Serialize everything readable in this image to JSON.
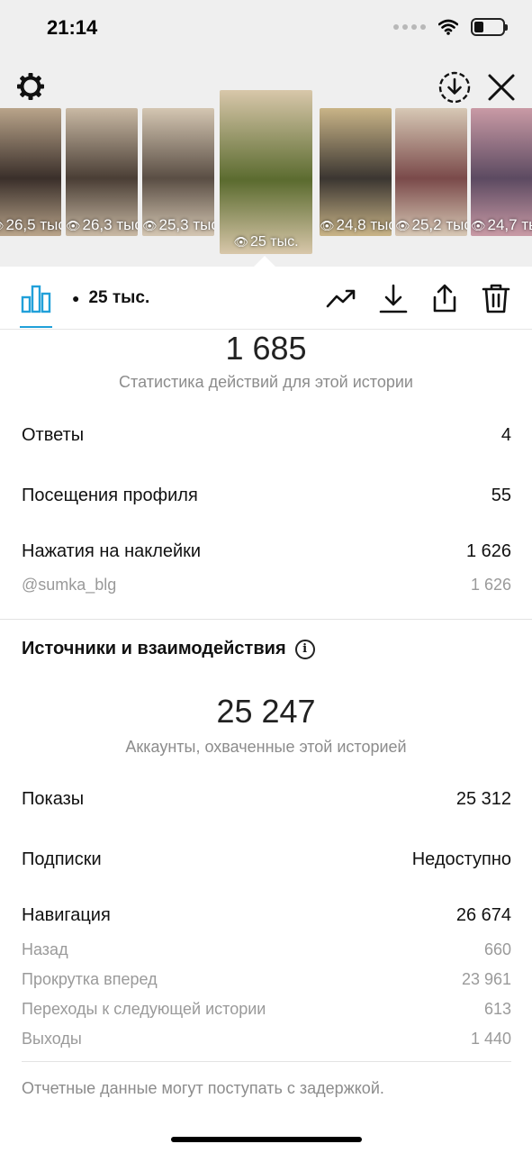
{
  "status": {
    "time": "21:14"
  },
  "stories": [
    {
      "views": "26,5 тыс.",
      "colors": [
        "#3a2f2a",
        "#b9a48a"
      ]
    },
    {
      "views": "26,3 тыс.",
      "colors": [
        "#4a3e35",
        "#c9b9a4"
      ]
    },
    {
      "views": "25,3 тыс.",
      "colors": [
        "#5a4e44",
        "#d4c6b2"
      ]
    },
    {
      "views": "25 тыс.",
      "colors": [
        "#5b6b2f",
        "#d8c7aa"
      ],
      "selected": true
    },
    {
      "views": "24,8 тыс.",
      "colors": [
        "#3b3631",
        "#c9b487"
      ]
    },
    {
      "views": "25,2 тыс.",
      "colors": [
        "#7a4a4a",
        "#d7c8b5"
      ]
    },
    {
      "views": "24,7 тыс.",
      "colors": [
        "#5c4a61",
        "#c99aa5"
      ]
    }
  ],
  "toolbar": {
    "views_label": "25 тыс."
  },
  "actions": {
    "total": "1 685",
    "caption": "Статистика действий для этой истории",
    "replies_label": "Ответы",
    "replies_value": "4",
    "profile_visits_label": "Посещения профиля",
    "profile_visits_value": "55",
    "sticker_taps_label": "Нажатия на наклейки",
    "sticker_taps_value": "1 626",
    "sticker_handle": "@sumka_blg",
    "sticker_handle_value": "1 626"
  },
  "discovery": {
    "title": "Источники и взаимодействия",
    "reach": "25 247",
    "reach_caption": "Аккаунты, охваченные этой историей",
    "impressions_label": "Показы",
    "impressions_value": "25 312",
    "follows_label": "Подписки",
    "follows_value": "Недоступно",
    "navigation_label": "Навигация",
    "navigation_value": "26 674",
    "back_label": "Назад",
    "back_value": "660",
    "forward_label": "Прокрутка вперед",
    "forward_value": "23 961",
    "next_story_label": "Переходы к следующей истории",
    "next_story_value": "613",
    "exits_label": "Выходы",
    "exits_value": "1 440"
  },
  "footer": "Отчетные данные могут поступать с задержкой.",
  "colors": {
    "accent": "#21a0d9"
  }
}
